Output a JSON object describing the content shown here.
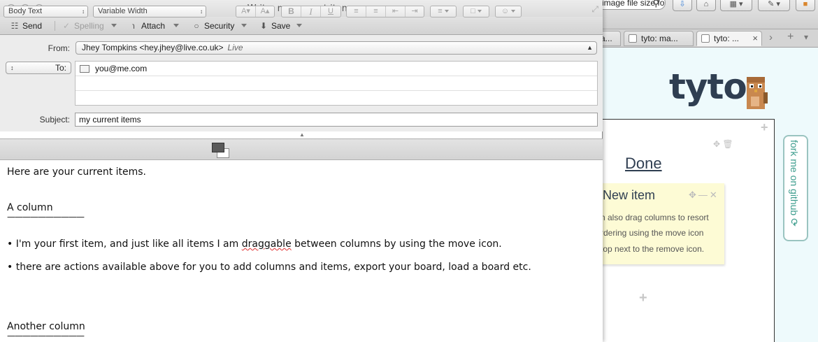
{
  "browser": {
    "url_fragment": "image file size for website",
    "tabs": [
      {
        "label": "a...",
        "active": false
      },
      {
        "label": "tyto: ma...",
        "active": false
      },
      {
        "label": "tyto: ...",
        "active": true
      }
    ],
    "tab_close": "×",
    "tab_next": "›",
    "tab_add": "+",
    "tab_more": "▾"
  },
  "tyto": {
    "logo_text": "tyto",
    "board_add": "+",
    "column_title": "Done",
    "item": {
      "title": "New item",
      "lines": [
        "n also drag columns to resort",
        "rdering using the move icon",
        "top next to the remove icon."
      ]
    },
    "item_add": "+",
    "fork_ribbon": "fork me on github"
  },
  "mail": {
    "window_title": "Write: my current items",
    "toolbar": {
      "send": "Send",
      "spelling": "Spelling",
      "attach": "Attach",
      "security": "Security",
      "save": "Save"
    },
    "from_label": "From:",
    "from_value": "Jhey Tompkins <hey.jhey@live.co.uk>",
    "from_account_status": "Live",
    "addr_type": "To:",
    "to_value": "you@me.com",
    "subject_label": "Subject:",
    "subject_value": "my current items",
    "format": {
      "paragraph_style": "Body Text",
      "font": "Variable Width"
    },
    "body": {
      "intro": "Here are your current items.",
      "col1_title": "A column",
      "col1_rule": "——————————",
      "item1_pre": "• I'm your first item, and just like all items I am ",
      "item1_misspelled": "draggable",
      "item1_post": " between columns by using the move icon.",
      "item2": "• there are actions available above for you to add columns and items, export your board, load a board etc.",
      "col2_title": "Another column",
      "col2_rule": "——————————"
    }
  },
  "colors": {
    "tyto_navy": "#2f3e51",
    "fork_green": "#3b9c8c",
    "item_yellow": "#fdfbd5",
    "spell_red": "#e03030"
  }
}
